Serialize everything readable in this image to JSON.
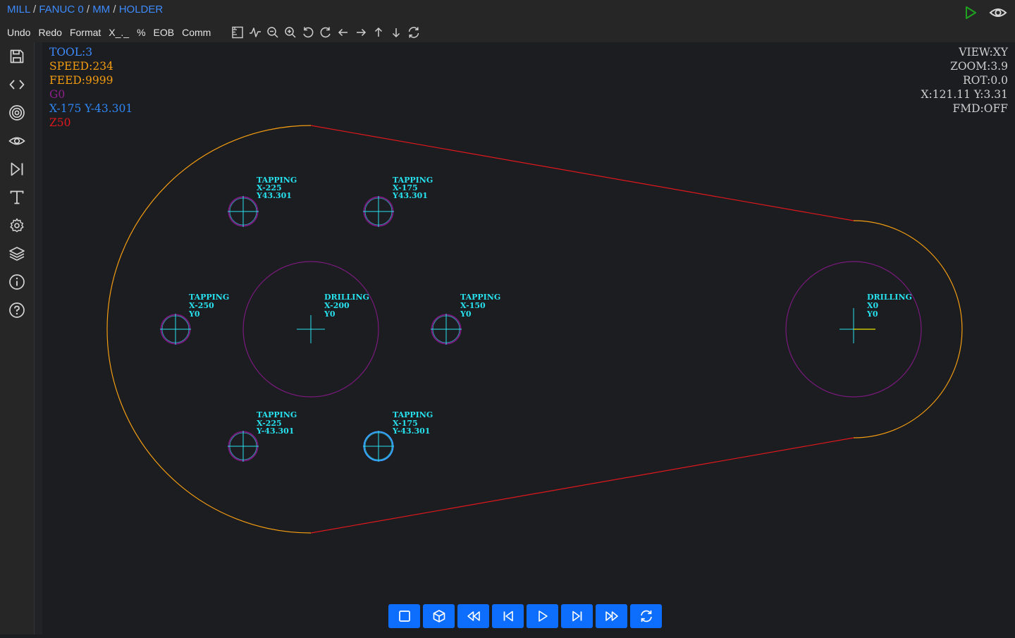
{
  "breadcrumb": [
    "MILL",
    "FANUC 0",
    "MM",
    "HOLDER"
  ],
  "menu": [
    "Undo",
    "Redo",
    "Format",
    "X_._",
    "%",
    "EOB",
    "Comm"
  ],
  "toolbar_icons": [
    "ruler-icon",
    "waveform-icon",
    "zoom-out-icon",
    "zoom-in-icon",
    "rotate-left-icon",
    "rotate-right-icon",
    "arrow-left-icon",
    "arrow-right-icon",
    "arrow-up-icon",
    "arrow-down-icon",
    "refresh-icon"
  ],
  "sidebar_icons": [
    "save-icon",
    "code-icon",
    "target-icon",
    "eye-icon",
    "skip-end-icon",
    "text-icon",
    "gear-icon",
    "layers-icon",
    "info-icon",
    "help-icon"
  ],
  "status_left": {
    "tool": "TOOL:3",
    "speed": "SPEED:234",
    "feed": "FEED:9999",
    "gcode": "G0",
    "position": "X-175 Y-43.301",
    "z": "Z50"
  },
  "status_right": {
    "view": "VIEW:XY",
    "zoom": "ZOOM:3.9",
    "rot": "ROT:0.0",
    "coords": "X:121.11 Y:3.31",
    "fmd": "FMD:OFF"
  },
  "holes": [
    {
      "op": "TAPPING",
      "x": "X-225",
      "y": "Y43.301"
    },
    {
      "op": "TAPPING",
      "x": "X-175",
      "y": "Y43.301"
    },
    {
      "op": "TAPPING",
      "x": "X-250",
      "y": "Y0"
    },
    {
      "op": "DRILLING",
      "x": "X-200",
      "y": "Y0"
    },
    {
      "op": "TAPPING",
      "x": "X-150",
      "y": "Y0"
    },
    {
      "op": "TAPPING",
      "x": "X-225",
      "y": "Y-43.301"
    },
    {
      "op": "TAPPING",
      "x": "X-175",
      "y": "Y-43.301"
    },
    {
      "op": "DRILLING",
      "x": "X0",
      "y": "Y0"
    }
  ],
  "playback_icons": [
    "stop-icon",
    "cube-icon",
    "rewind-icon",
    "step-back-icon",
    "play-icon",
    "step-forward-icon",
    "fast-forward-icon",
    "loop-icon"
  ],
  "colors": {
    "accent": "#0d6efd",
    "link": "#3d8bfd",
    "tool": "#3d8bfd",
    "speed": "#f39c12",
    "feed": "#f39c12",
    "gcode": "#8e1f8e",
    "position": "#2f86f5",
    "z": "#e0181e",
    "contour_arc": "#f39c12",
    "contour_line": "#e0181e",
    "hole_circle": "#7a1a7e",
    "label": "#27e1ee",
    "run": "#1fa31f"
  }
}
